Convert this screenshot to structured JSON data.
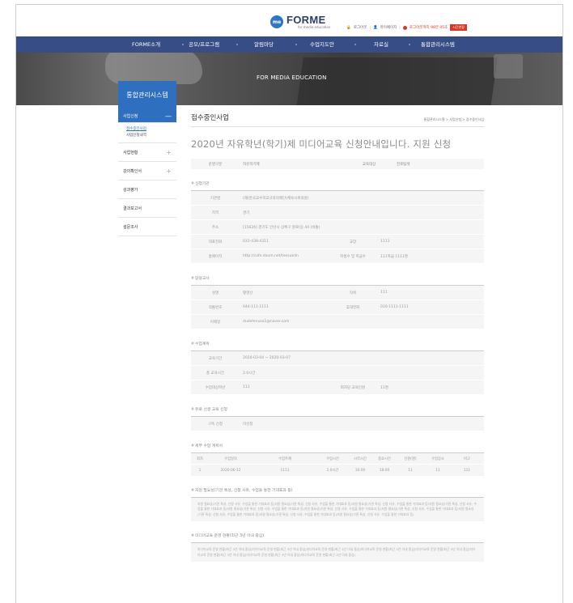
{
  "brand": {
    "name": "FORME",
    "tagline": "for media education",
    "mark": "me"
  },
  "util": {
    "link1": "로그아웃",
    "link2": "마이페이지",
    "warning": "로그아웃까지 98분 05초",
    "extend": "시간연장"
  },
  "nav": [
    "FORME소개",
    "공모/프로그램",
    "알림마당",
    "수업지도안",
    "자료실",
    "통합관리시스템"
  ],
  "hero": {
    "caption": "FOR MEDIA EDUCATION"
  },
  "sidebar": {
    "title": "통합관리시스템",
    "items": [
      {
        "label": "사업신청",
        "sign": "—"
      },
      {
        "label": "사업현황",
        "sign": "+"
      },
      {
        "label": "강의확인서",
        "sign": "+"
      },
      {
        "label": "성과평가",
        "sign": ""
      },
      {
        "label": "결과보고서",
        "sign": ""
      },
      {
        "label": "설문조사",
        "sign": ""
      }
    ],
    "sub": [
      "접수중인사업",
      "사업신청내역"
    ]
  },
  "content": {
    "page_title": "접수중인사업",
    "breadcrumb": "통합관리시스템 > 사업신청 > 접수중인사업",
    "apply_title": "2020년 자유학년(학기)제 미디어교육 신청안내입니다. 지원 신청",
    "top": {
      "l1": "운영구분",
      "v1": "자유학기제",
      "l2": "교육대상",
      "v2": "진로탐색"
    },
    "sec_apply": "신청기관",
    "apply_rows": [
      {
        "l": "기관명",
        "v": "(재)한국교수학교규약의제단(체육시위의원)"
      },
      {
        "l": "지역",
        "v": "경기"
      },
      {
        "l": "주소",
        "v": "[15626] 경기도 안산시 상록구 원로(동 44 (비통)"
      },
      {
        "l": "대표전화",
        "v": "031-438-4311",
        "l2": "교장",
        "v2": "1111"
      },
      {
        "l": "홈페이지",
        "v": "http://cafe.daum.net/teesukdn",
        "l2": "학생수 및 학급수",
        "v2": "111학급 1111명"
      }
    ],
    "sec_manager": "담당교사",
    "manager_rows": [
      {
        "l": "성명",
        "v": "황명선",
        "l2": "직위",
        "v2": "111"
      },
      {
        "l": "직통번호",
        "v": "044-111-1111",
        "l2": "휴대전화",
        "v2": "010-1111-1111"
      },
      {
        "l": "이메일",
        "v": "dudehmusa1@naver.com"
      }
    ],
    "sec_plan": "수업계획",
    "plan_rows": [
      {
        "l": "교육기간",
        "v": "2020-03-04 ~ 2020-03-07"
      },
      {
        "l": "총 교육시간",
        "v": "2.0시간"
      },
      {
        "l": "수업대상학년",
        "v": "111",
        "l2": "회차당 교육인원",
        "v2": "11명"
      }
    ],
    "sec_course": "유로 선생 교육 신청",
    "course_row": {
      "l": "구독 신청",
      "v": "미신청"
    },
    "sec_sched": "세부 수업 계획서",
    "sched_head": [
      "회차",
      "수업일자",
      "수업주제",
      "수업시간",
      "시작시간",
      "종료시간",
      "인원(명)",
      "수업장소",
      "비고"
    ],
    "sched_row": [
      "1",
      "2020-06-12",
      "1111",
      "2.0시간",
      "16:00",
      "18:00",
      "11",
      "11",
      "111"
    ],
    "sec_need": "지원 필요성(기관 특성, 신청 사유, 수업을 통한 기대효과 등)",
    "need_text": "지원 필요성(기관 특성, 신청 사유, 수업을 통한 기대효과 등)지원 필요성(기관 특성, 신청 사유, 수업을 통한 기대효과 등)지원 필요성(기관 특성, 신청 사유, 수업을 통한 기대효과 등)지원 필요성(기관 특성, 신청 사유, 수업을 통한 기대효과 등)지원 필요성(기관 특성, 신청 사유, 수업을 통한 기대효과 등)지원 필요성(기관 특성, 신청 사유, 수업을 통한 기대효과 등)지원 필요성(기관 특성, 신청 사유, 수업을 통한 기대효과 등)지원 필요성(기관 특성, 신청 사유, 수업을 통한 기대효과 등)지원 필요성(기관 특성, 신청 사유, 수업을 통한 기대효과 등)지원 필요성(기관 특성, 신청 사유, 수업을 통한 기대효과 등)",
    "sec_media": "미디어교육 운영 현황(최근 3년 이내 중심)",
    "media_text": "미디어교육 운영 현황(최근 3년 이내 중심)미디어교육 운영 현황(최근 3년 이내 중심)미디어교육 운영 현황(최근 3년 이내 중심)미디어교육 운영 현황(최근 3년 이내 중심)미디어교육 운영 현황(최근 3년 이내 중심)미디어교육 운영 현황(최근 3년 이내 중심)미디어교육 운영 현황(최근 3년 이내 중심)미디어교육 운영 현황(최근 3년 이내 중심)"
  },
  "colors": {
    "nav": "#364d86",
    "accent": "#2f6fbf",
    "warning": "#d03a2a"
  }
}
